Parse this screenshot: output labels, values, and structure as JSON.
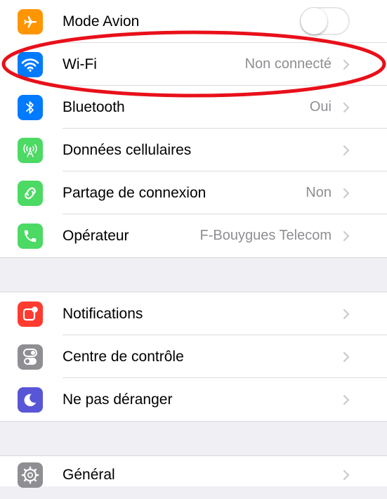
{
  "sections": [
    {
      "rows": [
        {
          "id": "airplane",
          "label": "Mode Avion",
          "icon": "airplane-icon",
          "icon_color": "#ff9500",
          "control": "toggle",
          "toggle_on": false
        },
        {
          "id": "wifi",
          "label": "Wi-Fi",
          "value": "Non connecté",
          "icon": "wifi-icon",
          "icon_color": "#007aff",
          "highlighted": true
        },
        {
          "id": "bluetooth",
          "label": "Bluetooth",
          "value": "Oui",
          "icon": "bluetooth-icon",
          "icon_color": "#007aff"
        },
        {
          "id": "cellular",
          "label": "Données cellulaires",
          "value": "",
          "icon": "cellular-antenna-icon",
          "icon_color": "#4cd964"
        },
        {
          "id": "hotspot",
          "label": "Partage de connexion",
          "value": "Non",
          "icon": "hotspot-link-icon",
          "icon_color": "#4cd964"
        },
        {
          "id": "carrier",
          "label": "Opérateur",
          "value": "F-Bouygues Telecom",
          "icon": "phone-icon",
          "icon_color": "#4cd964"
        }
      ]
    },
    {
      "rows": [
        {
          "id": "notifications",
          "label": "Notifications",
          "value": "",
          "icon": "notifications-icon",
          "icon_color": "#ff3b30"
        },
        {
          "id": "control-center",
          "label": "Centre de contrôle",
          "value": "",
          "icon": "control-center-icon",
          "icon_color": "#8e8e93"
        },
        {
          "id": "dnd",
          "label": "Ne pas déranger",
          "value": "",
          "icon": "moon-icon",
          "icon_color": "#5856d6"
        }
      ]
    },
    {
      "rows": [
        {
          "id": "general",
          "label": "Général",
          "value": "",
          "icon": "gear-icon",
          "icon_color": "#8e8e93"
        }
      ]
    }
  ],
  "annotation": {
    "shape": "ellipse",
    "color": "#e8101a",
    "target": "wifi"
  }
}
